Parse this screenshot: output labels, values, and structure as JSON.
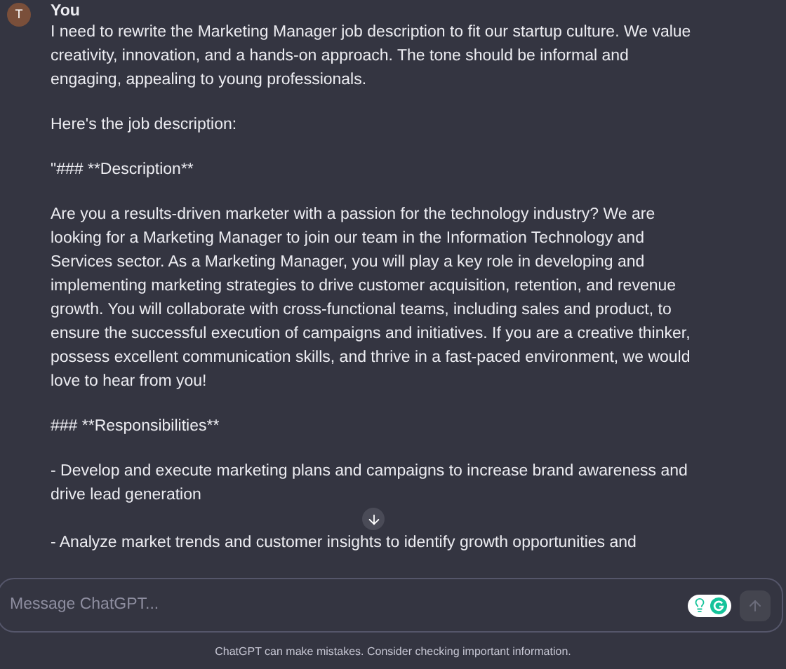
{
  "message": {
    "author": "You",
    "avatar_letter": "T",
    "paragraphs": [
      "I need to rewrite the Marketing Manager job description to fit our startup culture. We value creativity, innovation, and a hands-on approach. The tone should be informal and engaging, appealing to young professionals.",
      "Here's the job description:",
      "\"### **Description**",
      "Are you a results-driven marketer with a passion for the technology industry? We are looking for a Marketing Manager to join our team in the Information Technology and Services sector. As a Marketing Manager, you will play a key role in developing and implementing marketing strategies to drive customer acquisition, retention, and revenue growth. You will collaborate with cross-functional teams, including sales and product, to ensure the successful execution of campaigns and initiatives. If you are a creative thinker, possess excellent communication skills, and thrive in a fast-paced environment, we would love to hear from you!",
      "### **Responsibilities**"
    ],
    "bullets": [
      "- Develop and execute marketing plans and campaigns to increase brand awareness and drive lead generation",
      "- Analyze market trends and customer insights to identify growth opportunities and"
    ]
  },
  "composer": {
    "placeholder": "Message ChatGPT..."
  },
  "footer": "ChatGPT can make mistakes. Consider checking important information."
}
